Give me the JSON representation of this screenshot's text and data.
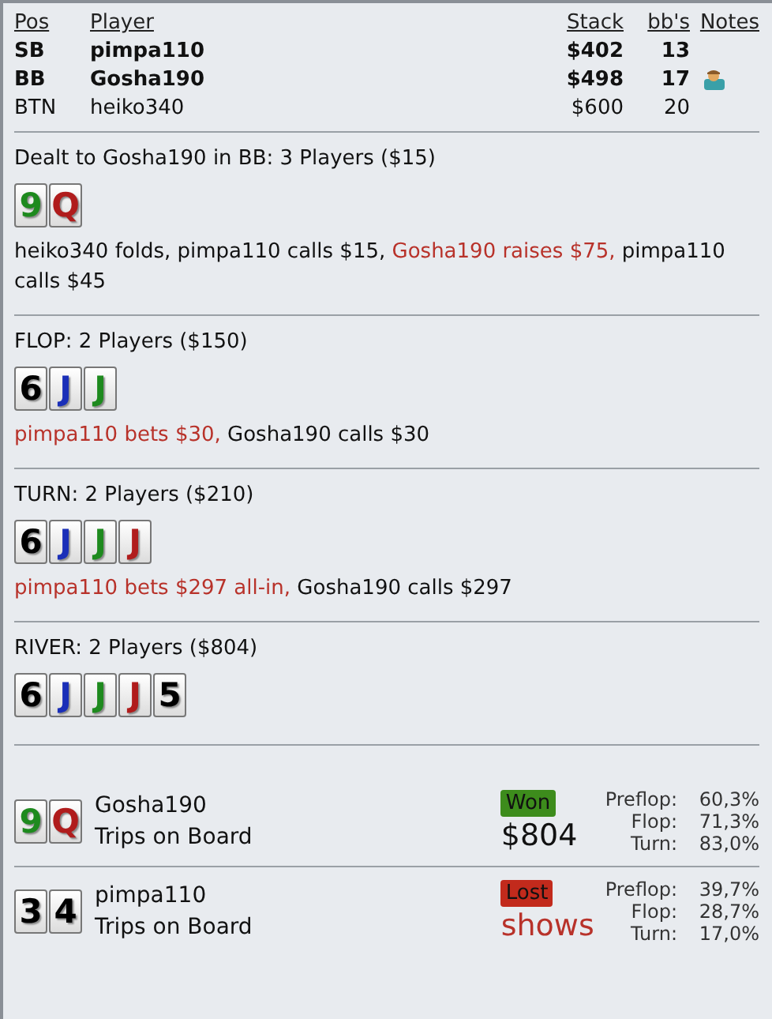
{
  "players": {
    "columns": [
      "Pos",
      "Player",
      "Stack",
      "bb's",
      "Notes"
    ],
    "rows": [
      {
        "pos": "SB",
        "name": "pimpa110",
        "stack": "$402",
        "bbs": "13",
        "bold": true,
        "has_note": false
      },
      {
        "pos": "BB",
        "name": "Gosha190",
        "stack": "$498",
        "bbs": "17",
        "bold": true,
        "has_note": true
      },
      {
        "pos": "BTN",
        "name": "heiko340",
        "stack": "$600",
        "bbs": "20",
        "bold": false,
        "has_note": false
      }
    ]
  },
  "streets": [
    {
      "title": "Dealt to Gosha190 in BB: 3 Players ($15)",
      "cards": [
        {
          "rank": "9",
          "color": "#1e8a1e"
        },
        {
          "rank": "Q",
          "color": "#b01c1c"
        }
      ],
      "actions": [
        {
          "text": "heiko340 folds, pimpa110 calls $15, ",
          "kind": "passive"
        },
        {
          "text": "Gosha190 raises $75,",
          "kind": "aggressive"
        },
        {
          "text": " pimpa110 calls $45",
          "kind": "passive"
        }
      ]
    },
    {
      "title": "FLOP: 2 Players ($150)",
      "cards": [
        {
          "rank": "6",
          "color": "#000000"
        },
        {
          "rank": "J",
          "color": "#1a2fb8"
        },
        {
          "rank": "J",
          "color": "#1e8a1e"
        }
      ],
      "actions": [
        {
          "text": "pimpa110 bets $30,",
          "kind": "aggressive"
        },
        {
          "text": " Gosha190 calls $30",
          "kind": "passive"
        }
      ]
    },
    {
      "title": "TURN: 2 Players ($210)",
      "cards": [
        {
          "rank": "6",
          "color": "#000000"
        },
        {
          "rank": "J",
          "color": "#1a2fb8"
        },
        {
          "rank": "J",
          "color": "#1e8a1e"
        },
        {
          "rank": "J",
          "color": "#b01c1c"
        }
      ],
      "actions": [
        {
          "text": "pimpa110 bets $297 all-in,",
          "kind": "aggressive"
        },
        {
          "text": " Gosha190 calls $297",
          "kind": "passive"
        }
      ]
    },
    {
      "title": "RIVER: 2 Players ($804)",
      "cards": [
        {
          "rank": "6",
          "color": "#000000"
        },
        {
          "rank": "J",
          "color": "#1a2fb8"
        },
        {
          "rank": "J",
          "color": "#1e8a1e"
        },
        {
          "rank": "J",
          "color": "#b01c1c"
        },
        {
          "rank": "5",
          "color": "#000000"
        }
      ]
    }
  ],
  "showdown": [
    {
      "cards": [
        {
          "rank": "9",
          "color": "#1e8a1e"
        },
        {
          "rank": "Q",
          "color": "#b01c1c"
        }
      ],
      "name": "Gosha190",
      "hand": "Trips on Board",
      "result": "Won",
      "kind": "won",
      "amount": "$804",
      "equity": [
        {
          "label": "Preflop:",
          "value": "60,3%"
        },
        {
          "label": "Flop:",
          "value": "71,3%"
        },
        {
          "label": "Turn:",
          "value": "83,0%"
        }
      ]
    },
    {
      "cards": [
        {
          "rank": "3",
          "color": "#000000"
        },
        {
          "rank": "4",
          "color": "#000000"
        }
      ],
      "name": "pimpa110",
      "hand": "Trips on Board",
      "result": "Lost",
      "kind": "lost",
      "amount": "shows",
      "equity": [
        {
          "label": "Preflop:",
          "value": "39,7%"
        },
        {
          "label": "Flop:",
          "value": "28,7%"
        },
        {
          "label": "Turn:",
          "value": "17,0%"
        }
      ]
    }
  ]
}
